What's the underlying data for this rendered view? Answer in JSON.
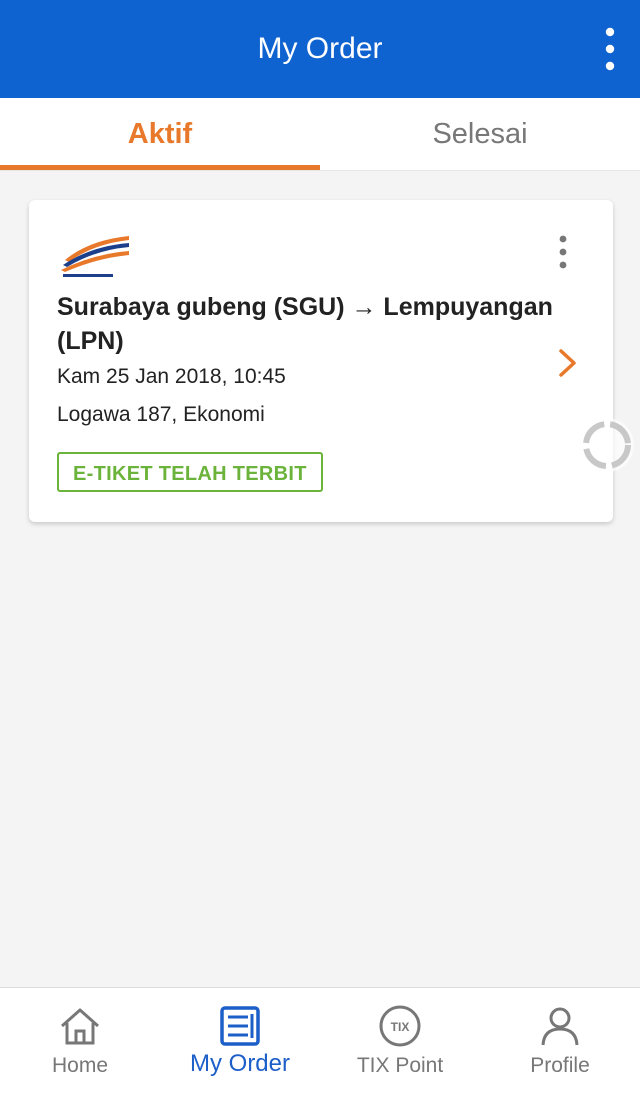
{
  "appbar": {
    "title": "My Order",
    "menu_icon": "more-vert-icon"
  },
  "tabs": [
    {
      "label": "Aktif",
      "active": true
    },
    {
      "label": "Selesai",
      "active": false
    }
  ],
  "order": {
    "logo_icon": "kereta-api-logo",
    "route": "Surabaya gubeng (SGU) → Lempuyangan (LPN)",
    "datetime": "Kam 25 Jan 2018, 10:45",
    "train": "Logawa 187, Ekonomi",
    "status": "E-TIKET TELAH TERBIT"
  },
  "bottom_nav": [
    {
      "label": "Home",
      "icon": "home-icon"
    },
    {
      "label": "My Order",
      "icon": "order-list-icon"
    },
    {
      "label": "TIX Point",
      "icon": "tix-point-icon"
    },
    {
      "label": "Profile",
      "icon": "profile-icon"
    }
  ],
  "colors": {
    "primary": "#0f63d0",
    "accent": "#e8782a",
    "success": "#6bb33b",
    "nav_active": "#1d5fc9"
  }
}
